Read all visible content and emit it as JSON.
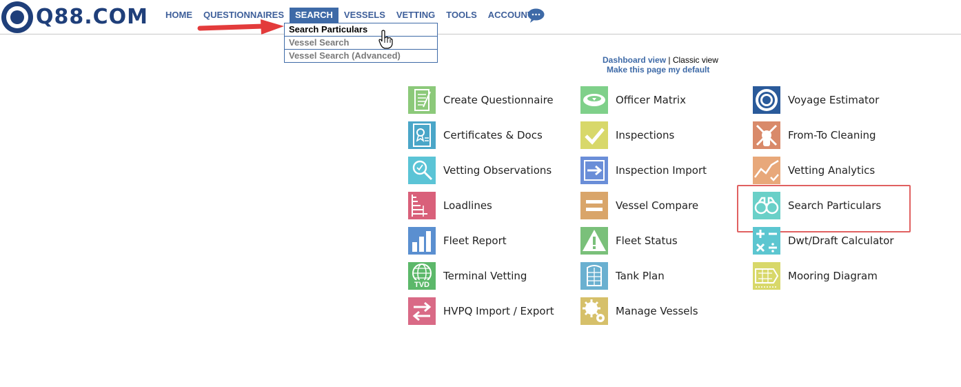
{
  "logo": {
    "text": "Q88.COM"
  },
  "nav": [
    {
      "label": "HOME"
    },
    {
      "label": "QUESTIONNAIRES"
    },
    {
      "label": "SEARCH"
    },
    {
      "label": "VESSELS"
    },
    {
      "label": "VETTING"
    },
    {
      "label": "TOOLS"
    },
    {
      "label": "ACCOUNT"
    }
  ],
  "dropdown": [
    {
      "label": "Search Particulars"
    },
    {
      "label": "Vessel Search"
    },
    {
      "label": "Vessel Search (Advanced)"
    }
  ],
  "views": {
    "dashboard": "Dashboard view",
    "separator": "|",
    "classic": "Classic view",
    "make_default": "Make this page my default"
  },
  "tiles": {
    "col1": [
      {
        "label": "Create Questionnaire",
        "icon": "questionnaire-icon",
        "color": "#8cc97a"
      },
      {
        "label": "Certificates & Docs",
        "icon": "certificate-icon",
        "color": "#4aa6c8"
      },
      {
        "label": "Vetting Observations",
        "icon": "magnifier-icon",
        "color": "#5bc4d6"
      },
      {
        "label": "Loadlines",
        "icon": "loadline-icon",
        "color": "#d9607a"
      },
      {
        "label": "Fleet Report",
        "icon": "bar-chart-icon",
        "color": "#5a8fd0"
      },
      {
        "label": "Terminal Vetting",
        "icon": "globe-icon",
        "color": "#5cb86a"
      },
      {
        "label": "HVPQ Import / Export",
        "icon": "swap-arrows-icon",
        "color": "#d96a86"
      }
    ],
    "col2": [
      {
        "label": "Officer Matrix",
        "icon": "officer-cap-icon",
        "color": "#7fd08a"
      },
      {
        "label": "Inspections",
        "icon": "checkmark-icon",
        "color": "#d8d86a"
      },
      {
        "label": "Inspection Import",
        "icon": "import-arrow-icon",
        "color": "#6a8ed8"
      },
      {
        "label": "Vessel Compare",
        "icon": "equals-icon",
        "color": "#d9a56a"
      },
      {
        "label": "Fleet Status",
        "icon": "warning-icon",
        "color": "#7ac07a"
      },
      {
        "label": "Tank Plan",
        "icon": "tank-plan-icon",
        "color": "#6ab0d0"
      },
      {
        "label": "Manage Vessels",
        "icon": "gears-icon",
        "color": "#d6c06a"
      }
    ],
    "col3": [
      {
        "label": "Voyage Estimator",
        "icon": "target-icon",
        "color": "#2a5a9a"
      },
      {
        "label": "From-To Cleaning",
        "icon": "cleaning-icon",
        "color": "#d98a6a"
      },
      {
        "label": "Vetting Analytics",
        "icon": "analytics-icon",
        "color": "#e8a87a"
      },
      {
        "label": "Search Particulars",
        "icon": "binoculars-icon",
        "color": "#6ad0c8"
      },
      {
        "label": "Dwt/Draft Calculator",
        "icon": "calculator-icon",
        "color": "#5cc6d0"
      },
      {
        "label": "Mooring Diagram",
        "icon": "mooring-icon",
        "color": "#d8d86a"
      }
    ]
  },
  "accent": "#3e6aa7",
  "highlight_color": "#e06060"
}
